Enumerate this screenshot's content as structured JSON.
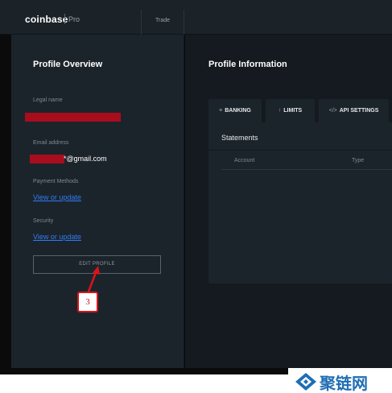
{
  "header": {
    "logo_text": "coinbase",
    "logo_pro": "Pro",
    "nav_trade": "Trade"
  },
  "profile_overview": {
    "title": "Profile Overview",
    "legal_name_label": "Legal name",
    "email_label": "Email address",
    "email_visible": "*@gmail.com",
    "payment_methods_label": "Payment Methods",
    "payment_link": "View or update",
    "security_label": "Security",
    "security_link": "View or update",
    "edit_button": "EDIT PROFILE"
  },
  "annotation": {
    "step_number": "3",
    "color": "#d8141a"
  },
  "profile_information": {
    "title": "Profile Information",
    "tabs": [
      {
        "icon": "bank-icon",
        "label": "BANKING"
      },
      {
        "icon": "up-arrow-icon",
        "label": "LIMITS"
      },
      {
        "icon": "code-icon",
        "label": "API SETTINGS"
      }
    ],
    "statements": {
      "title": "Statements",
      "columns": [
        "Account",
        "Type"
      ]
    }
  },
  "watermark": {
    "text": "聚链网",
    "color": "#1f6eb5"
  },
  "colors": {
    "accent_link": "#2e7cf6",
    "redaction": "#a80d1e",
    "panel": "#1c242b"
  }
}
